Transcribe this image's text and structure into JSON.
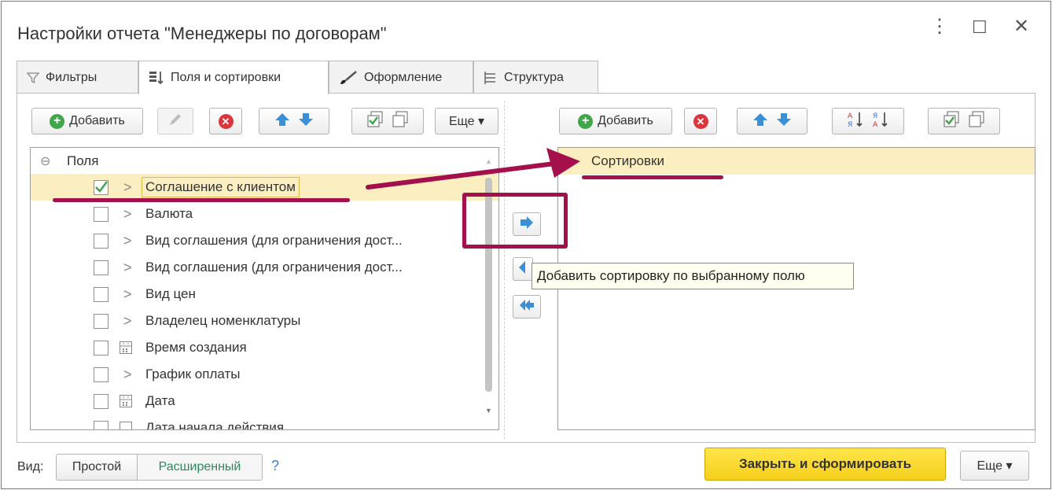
{
  "window": {
    "title": "Настройки отчета \"Менеджеры по договорам\"",
    "more_icon": "⋮",
    "maximize_icon": "☐",
    "close_icon": "✕"
  },
  "tabs": [
    {
      "label": "Фильтры",
      "icon": "filter-icon"
    },
    {
      "label": "Поля и сортировки",
      "icon": "fields-sort-icon",
      "active": true
    },
    {
      "label": "Оформление",
      "icon": "brush-icon"
    },
    {
      "label": "Структура",
      "icon": "structure-icon"
    }
  ],
  "left_toolbar": {
    "add_label": "Добавить",
    "more_label": "Еще ▾"
  },
  "right_toolbar": {
    "add_label": "Добавить"
  },
  "fields_tree": {
    "root": "Поля",
    "items": [
      {
        "label": "Соглашение с клиентом",
        "checked": true,
        "icon": "chevron-right-icon"
      },
      {
        "label": "Валюта",
        "checked": false,
        "icon": "chevron-right-icon"
      },
      {
        "label": "Вид соглашения (для ограничения дост...",
        "checked": false,
        "icon": "chevron-right-icon"
      },
      {
        "label": "Вид соглашения (для ограничения дост...",
        "checked": false,
        "icon": "chevron-right-icon"
      },
      {
        "label": "Вид цен",
        "checked": false,
        "icon": "chevron-right-icon"
      },
      {
        "label": "Владелец номенклатуры",
        "checked": false,
        "icon": "chevron-right-icon"
      },
      {
        "label": "Время создания",
        "checked": false,
        "icon": "calendar-icon"
      },
      {
        "label": "График оплаты",
        "checked": false,
        "icon": "chevron-right-icon"
      },
      {
        "label": "Дата",
        "checked": false,
        "icon": "calendar-icon"
      },
      {
        "label": "Дата начала действия",
        "checked": false,
        "icon": "calendar-icon"
      }
    ]
  },
  "sort_list": {
    "root": "Сортировки"
  },
  "tooltip": "Добавить сортировку по выбранному полю",
  "footer": {
    "view_label": "Вид:",
    "simple_label": "Простой",
    "extended_label": "Расширенный",
    "help_label": "?",
    "primary_label": "Закрыть и сформировать",
    "more_label": "Еще ▾"
  },
  "colors": {
    "accent_yellow": "#f5cf1b",
    "selection": "#fbefc2",
    "annotation": "#a4104b",
    "green": "#3fa64a",
    "red": "#d9363e",
    "blue_arrow": "#3a8fd6"
  }
}
